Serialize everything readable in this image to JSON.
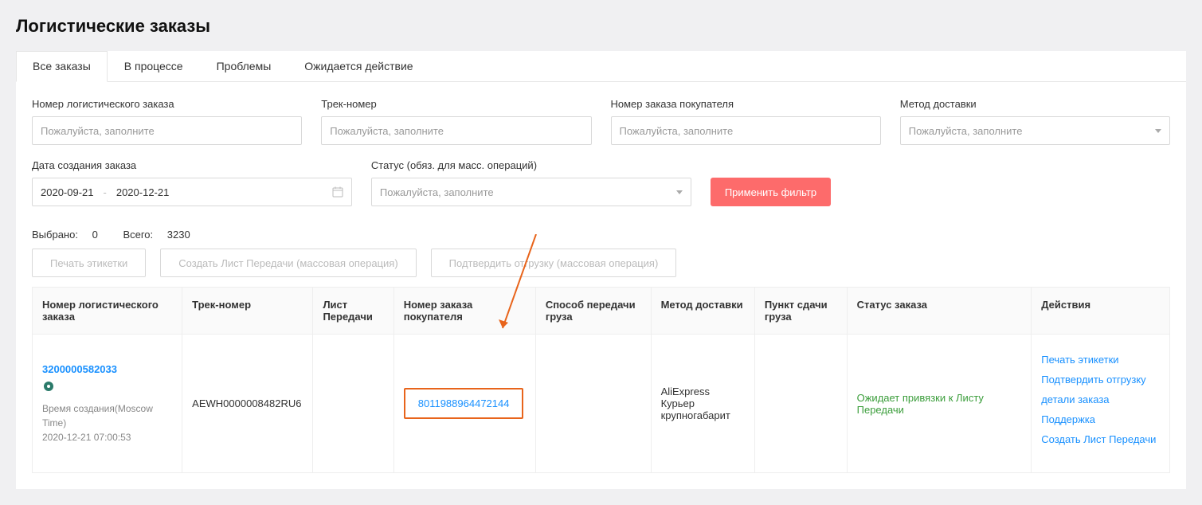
{
  "page": {
    "title": "Логистические заказы"
  },
  "tabs": [
    {
      "label": "Все заказы",
      "active": true
    },
    {
      "label": "В процессе",
      "active": false
    },
    {
      "label": "Проблемы",
      "active": false
    },
    {
      "label": "Ожидается действие",
      "active": false
    }
  ],
  "filters": {
    "order_no": {
      "label": "Номер логистического заказа",
      "placeholder": "Пожалуйста, заполните"
    },
    "track_no": {
      "label": "Трек-номер",
      "placeholder": "Пожалуйста, заполните"
    },
    "buyer_order": {
      "label": "Номер заказа покупателя",
      "placeholder": "Пожалуйста, заполните"
    },
    "delivery_method": {
      "label": "Метод доставки",
      "placeholder": "Пожалуйста, заполните"
    },
    "date_created": {
      "label": "Дата создания заказа",
      "from": "2020-09-21",
      "to": "2020-12-21"
    },
    "status": {
      "label": "Статус (обяз. для масс. операций)",
      "placeholder": "Пожалуйста, заполните"
    },
    "apply_btn": "Применить фильтр"
  },
  "selection": {
    "selected_label": "Выбрано:",
    "selected_count": "0",
    "total_label": "Всего:",
    "total_count": "3230"
  },
  "bulk": {
    "print": "Печать этикетки",
    "create_handover": "Создать Лист Передачи (массовая операция)",
    "confirm_ship": "Подтвердить отгрузку (массовая операция)"
  },
  "columns": {
    "logistic_order": "Номер логистического заказа",
    "track": "Трек-номер",
    "handover": "Лист Передачи",
    "buyer_order": "Номер заказа покупателя",
    "handover_method": "Способ передачи груза",
    "delivery_method": "Метод доставки",
    "dropoff": "Пункт сдачи груза",
    "status": "Статус заказа",
    "actions": "Действия"
  },
  "rows": [
    {
      "logistic_order": "3200000582033",
      "created_label": "Время создания(Moscow Time)",
      "created_at": "2020-12-21 07:00:53",
      "track": "AEWH0000008482RU6",
      "handover": "",
      "buyer_order": "8011988964472144",
      "handover_method": "",
      "delivery_method": "AliExpress Курьер крупногабарит",
      "dropoff": "",
      "status": "Ожидает привязки к Листу Передачи",
      "actions": {
        "print": "Печать этикетки",
        "confirm": "Подтвердить отгрузку",
        "details": "детали заказа",
        "support": "Поддержка",
        "create_handover": "Создать Лист Передачи"
      }
    }
  ]
}
